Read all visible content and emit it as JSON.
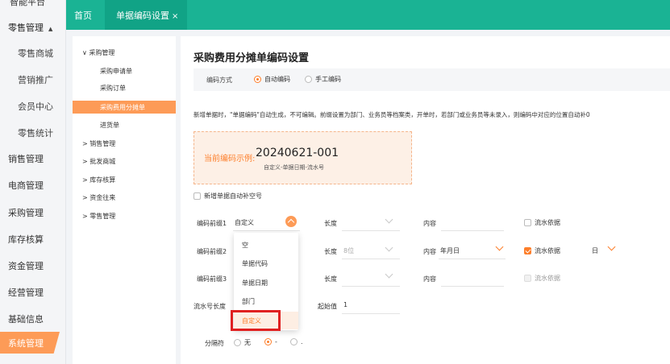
{
  "sidebar": {
    "top_cut": "智能平台",
    "groups": [
      {
        "label": "零售管理",
        "expanded": true,
        "caret": "▲"
      },
      {
        "label": "销售管理"
      },
      {
        "label": "电商管理"
      },
      {
        "label": "采购管理"
      },
      {
        "label": "库存核算"
      },
      {
        "label": "资金管理"
      },
      {
        "label": "经营管理"
      },
      {
        "label": "基础信息"
      },
      {
        "label": "系统管理",
        "active": true
      }
    ],
    "sub_items": [
      "零售商城",
      "营销推广",
      "会员中心",
      "零售统计"
    ]
  },
  "tabs": {
    "home": "首页",
    "active": "单据编码设置",
    "close": "×"
  },
  "tree": {
    "purchase_root": "采购管理",
    "purchase_children": [
      "采购申请单",
      "采购订单",
      "采购费用分摊单",
      "进货单"
    ],
    "selected_index": 2,
    "roots": [
      "销售管理",
      "批发商城",
      "库存核算",
      "资金往来",
      "零售管理"
    ],
    "expand_icon": "∨",
    "collapse_icon": ">"
  },
  "main": {
    "title": "采购费用分摊单编码设置",
    "mode_label": "编码方式",
    "mode_auto": "自动编码",
    "mode_manual": "手工编码",
    "description": "新增单据时，\"单据编码\"自动生成，不可编辑。前缀设置为部门、业务员等档案类，开单时，若部门或业务员等未录入，则编码中对应的位置自动补0",
    "example_label": "当前编码示例:",
    "example_value": "20240621-001",
    "example_sub": "自定义-单据日期-流水号",
    "fill_gap_label": "新增单据自动补空号",
    "rows": [
      {
        "label": "编码前缀1",
        "value": "自定义",
        "len_label": "长度",
        "len_value": "",
        "content_label": "内容",
        "content_value": "",
        "serial_label": "流水依据",
        "serial_checked": false
      },
      {
        "label": "编码前缀2",
        "value": "",
        "len_label": "长度",
        "len_value": "8位",
        "content_label": "内容",
        "content_value": "年月日",
        "serial_label": "流水依据",
        "serial_checked": true,
        "serial_unit": "日"
      },
      {
        "label": "编码前缀3",
        "value": "",
        "len_label": "长度",
        "len_value": "",
        "content_label": "内容",
        "content_value": "",
        "serial_label": "流水依据",
        "serial_checked": false
      }
    ],
    "serial_len_label": "流水号长度",
    "start_label": "起始值",
    "start_value": "1",
    "separator_label": "分隔符",
    "sep_none": "无",
    "sep_dash": "-",
    "sep_dot": "."
  },
  "dropdown": {
    "options": [
      "空",
      "单据代码",
      "单据日期",
      "部门",
      "自定义"
    ],
    "highlight_index": 4
  },
  "colors": {
    "teal": "#1ab394",
    "orange": "#fd9b57",
    "accent": "#fd7e2a",
    "annotation_red": "#e02020"
  }
}
